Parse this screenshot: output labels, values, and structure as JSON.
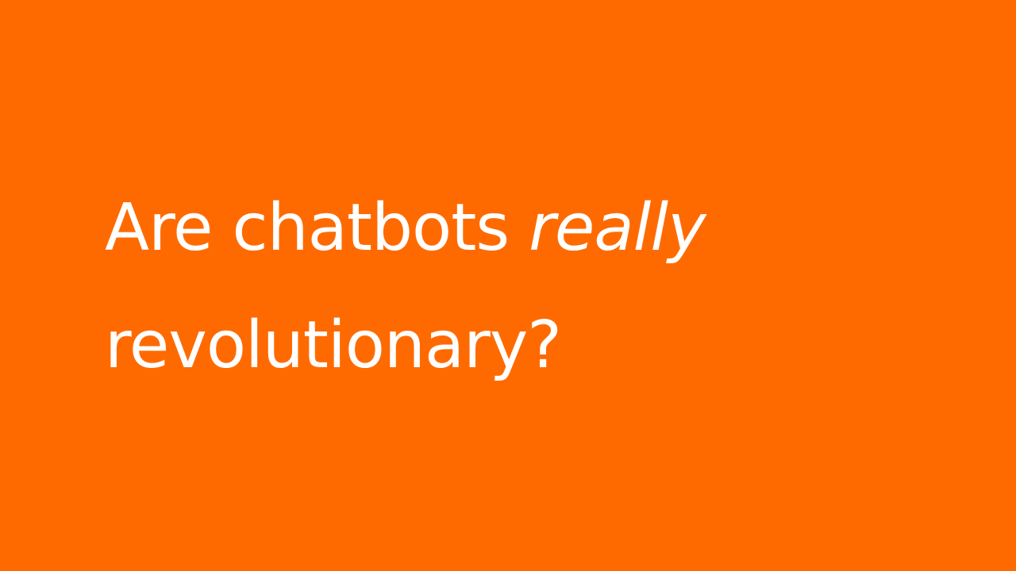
{
  "slide": {
    "background_color": "#FF6A00",
    "text_color": "#FFFFFF",
    "headline": {
      "line1_prefix": "Are chatbots",
      "line1_emphasis": "really",
      "line2": "revolutionary?"
    }
  }
}
